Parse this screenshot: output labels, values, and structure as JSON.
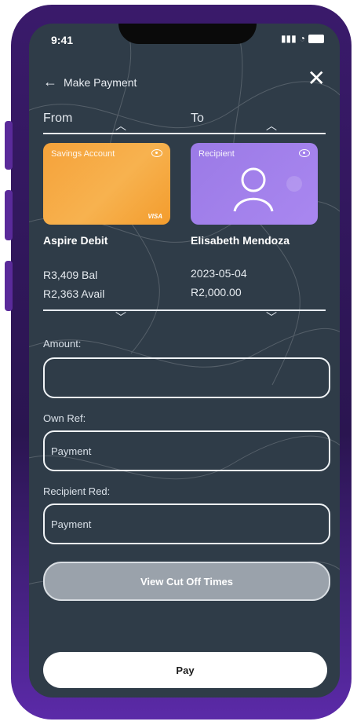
{
  "status_bar": {
    "time": "9:41"
  },
  "header": {
    "back_label": "Make Payment",
    "close_icon": "close-icon"
  },
  "from_to": {
    "from_label": "From",
    "to_label": "To"
  },
  "from_card": {
    "label": "Savings Account",
    "brand": "VISA",
    "color": "#F7A43D"
  },
  "to_card": {
    "label": "Recipient",
    "color": "#A07AE6"
  },
  "from_account": {
    "name": "Aspire Debit",
    "balance": "R3,409 Bal",
    "available": "R2,363 Avail"
  },
  "recipient": {
    "name": "Elisabeth Mendoza",
    "date": "2023-05-04",
    "amount": "R2,000.00"
  },
  "form": {
    "amount_label": "Amount:",
    "amount_value": "",
    "own_ref_label": "Own Ref:",
    "own_ref_value": "Payment",
    "recipient_ref_label": "Recipient Red:",
    "recipient_ref_value": "Payment"
  },
  "buttons": {
    "view_cutoff": "View Cut Off Times",
    "pay": "Pay"
  }
}
